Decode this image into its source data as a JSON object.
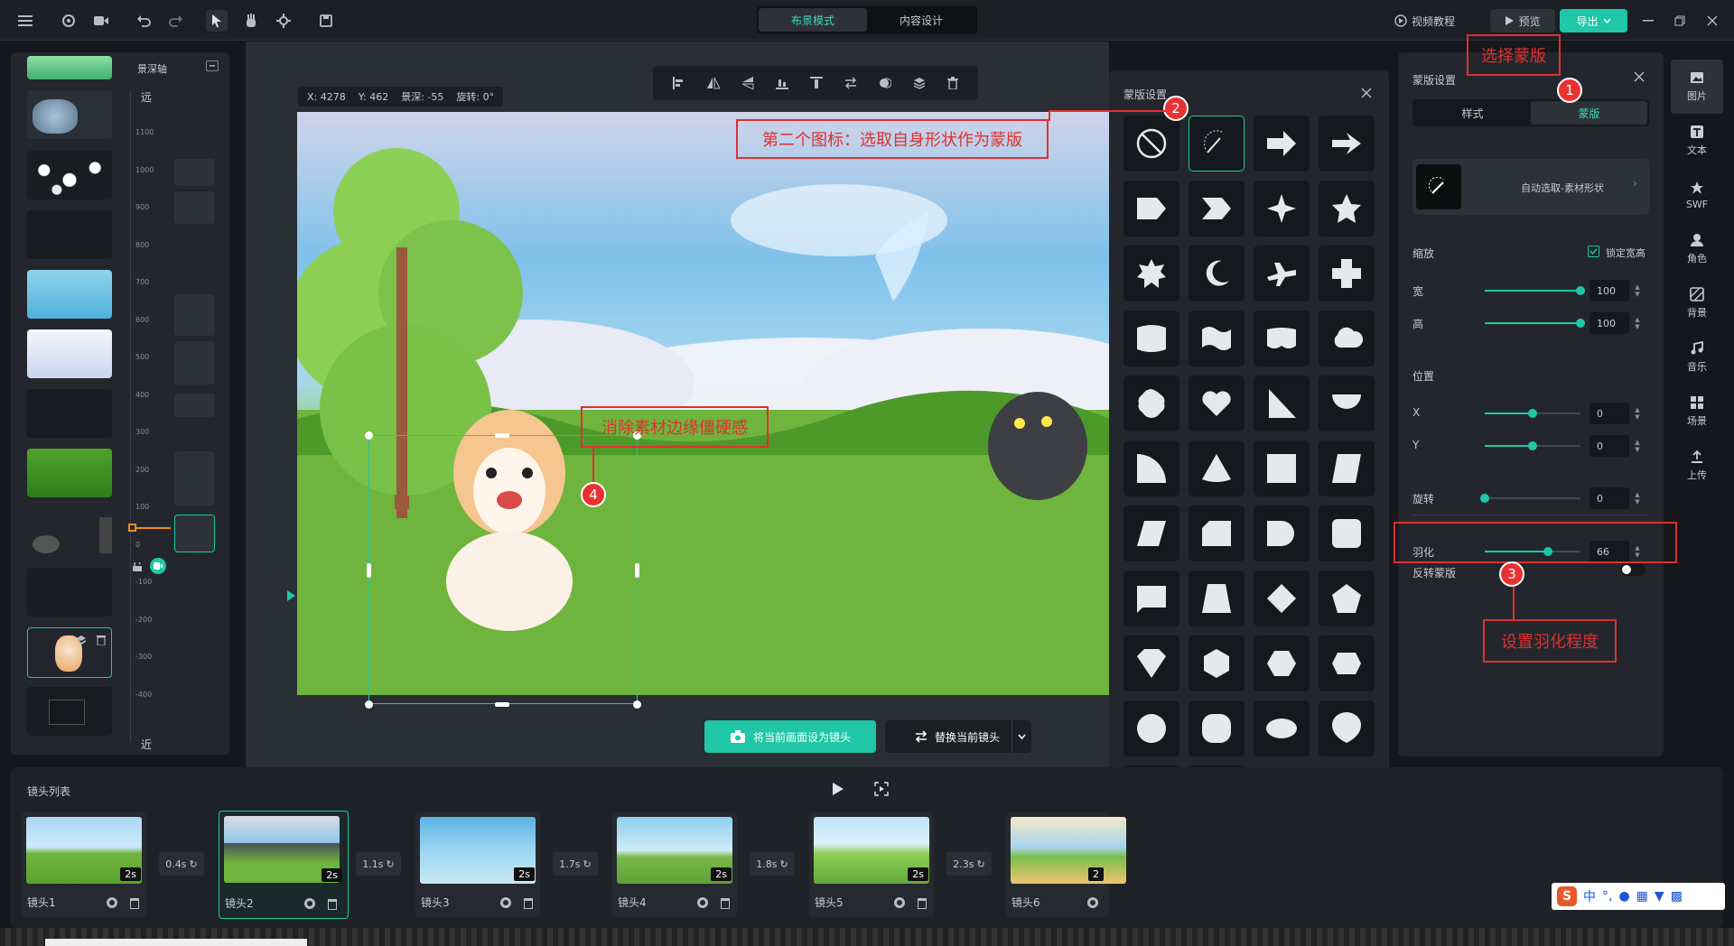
{
  "topbar": {
    "mode_tabs": [
      "布景模式",
      "内容设计"
    ],
    "active_mode": 0,
    "tutorial_label": "视频教程",
    "preview_label": "预览",
    "export_label": "导出"
  },
  "depth_axis": {
    "title": "景深轴",
    "near_top": "远",
    "near_bottom": "近",
    "ticks": [
      "1100",
      "1000",
      "900",
      "800",
      "700",
      "600",
      "500",
      "400",
      "300",
      "200",
      "100",
      "0",
      "-100",
      "-200",
      "-300",
      "-400"
    ]
  },
  "canvas": {
    "coords": {
      "x": "X: 4278",
      "y": "Y: 462",
      "depth": "景深: -55",
      "rotate": "旋转: 0°"
    },
    "set_camera_label": "将当前画面设为镜头",
    "replace_camera_label": "替换当前镜头"
  },
  "mask_popup": {
    "title": "蒙版设置"
  },
  "right_panel": {
    "title": "蒙版设置",
    "tabs": [
      "样式",
      "蒙版"
    ],
    "active_tab": 1,
    "auto_select_label": "自动选取-素材形状",
    "scale_label": "缩放",
    "lock_ratio_label": "锁定宽高",
    "width_label": "宽",
    "width_value": "100",
    "height_label": "高",
    "height_value": "100",
    "position_label": "位置",
    "x_label": "X",
    "x_value": "0",
    "y_label": "Y",
    "y_value": "0",
    "rotate_label": "旋转",
    "rotate_value": "0",
    "feather_label": "羽化",
    "feather_value": "66",
    "invert_label": "反转蒙版",
    "width_level": 1.0,
    "height_level": 1.0,
    "x_level": 0.5,
    "y_level": 0.5,
    "rotate_level": 0.0,
    "feather_level": 0.66
  },
  "side_nav": [
    "图片",
    "文本",
    "SWF",
    "角色",
    "背景",
    "音乐",
    "场景",
    "上传"
  ],
  "camera_list": {
    "title": "镜头列表",
    "cameras": [
      {
        "label": "镜头1",
        "duration": "2s"
      },
      {
        "label": "镜头2",
        "duration": "2s"
      },
      {
        "label": "镜头3",
        "duration": "2s"
      },
      {
        "label": "镜头4",
        "duration": "2s"
      },
      {
        "label": "镜头5",
        "duration": "2s"
      },
      {
        "label": "镜头6",
        "duration": "2"
      }
    ],
    "transitions": [
      "0.4s",
      "1.1s",
      "1.7s",
      "1.8s",
      "2.3s"
    ]
  },
  "annotations": {
    "a1_text": "选择蒙版",
    "a2_text": "第二个图标：选取自身形状作为蒙版",
    "a3_text": "设置羽化程度",
    "a4_text": "消除素材边缘僵硬感",
    "n1": "1",
    "n2": "2",
    "n3": "3",
    "n4": "4"
  },
  "ime": {
    "lang": "中"
  },
  "colors": {
    "accent": "#1fc7a6",
    "annotation": "#e03030",
    "panel": "#23272d"
  }
}
